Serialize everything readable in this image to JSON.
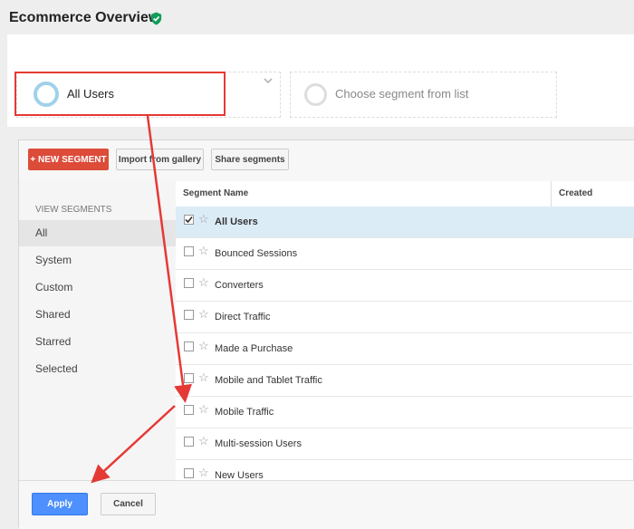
{
  "header": {
    "title": "Ecommerce Overview"
  },
  "segments": {
    "selected_label": "All Users",
    "choose_placeholder": "Choose segment from list"
  },
  "toolbar": {
    "new_segment_label": "+ NEW SEGMENT",
    "import_label": "Import from gallery",
    "share_label": "Share segments"
  },
  "sidebar": {
    "heading": "VIEW SEGMENTS",
    "items": [
      "All",
      "System",
      "Custom",
      "Shared",
      "Starred",
      "Selected"
    ]
  },
  "table": {
    "columns": [
      "Segment Name",
      "Created"
    ],
    "rows": [
      {
        "label": "All Users",
        "checked": true
      },
      {
        "label": "Bounced Sessions",
        "checked": false
      },
      {
        "label": "Converters",
        "checked": false
      },
      {
        "label": "Direct Traffic",
        "checked": false
      },
      {
        "label": "Made a Purchase",
        "checked": false
      },
      {
        "label": "Mobile and Tablet Traffic",
        "checked": false
      },
      {
        "label": "Mobile Traffic",
        "checked": false
      },
      {
        "label": "Multi-session Users",
        "checked": false
      },
      {
        "label": "New Users",
        "checked": false
      }
    ]
  },
  "footer": {
    "apply_label": "Apply",
    "cancel_label": "Cancel"
  },
  "colors": {
    "accent": "#4d90fe",
    "new_segment": "#dd4b39",
    "annotation": "#e53935",
    "selected_row": "#dcecf7"
  }
}
